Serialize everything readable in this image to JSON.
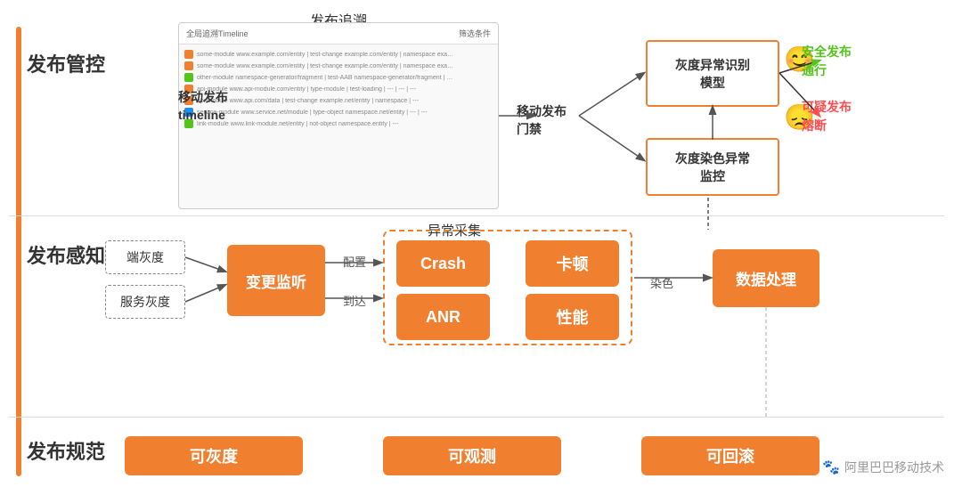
{
  "sections": {
    "fabukongzhi": {
      "label": "发布管控"
    },
    "fabuganzhi": {
      "label": "发布感知"
    },
    "fabuguguifan": {
      "label": "发布规范"
    }
  },
  "top": {
    "trace_title": "发布追溯",
    "mobile_timeline_line1": "移动发布",
    "mobile_timeline_line2": "timeline",
    "mobile_mengeng": "移动发布\n门禁",
    "gray_model": "灰度异常识别\n模型",
    "gray_monitor": "灰度染色异常\n监控",
    "safe_label_line1": "安全发布",
    "safe_label_line2": "通行",
    "suspicious_label_line1": "可疑发布",
    "suspicious_label_line2": "熔断",
    "exception_collect": "异常采集"
  },
  "middle": {
    "duan_gray": "端灰度",
    "service_gray": "服务灰度",
    "change_monitor": "变更监听",
    "config": "配置",
    "arrive": "到达",
    "crash": "Crash",
    "katun": "卡顿",
    "anr": "ANR",
    "performance": "性能",
    "ranse": "染色",
    "data_process": "数据处理"
  },
  "bottom": {
    "kegray": "可灰度",
    "keguance": "可观测",
    "kehui": "可回滚"
  },
  "watermark": "阿里巴巴移动技术",
  "trace_rows": [
    {
      "color": "orange",
      "text": "some-module www.example.com/entity  |  test-change example.com/entity  |  namespace example.com/entity  |  fix  |  ---"
    },
    {
      "color": "orange",
      "text": "some-module www.example.com/entity  |  test-change example.com/entity  |  namespace example.com/entity  |  fix  |  ---"
    },
    {
      "color": "green",
      "text": "other-module namespace-generator/fragment  |  test-AAB namespace-generator/fragment  |  namespace  |  ---  |  ---"
    },
    {
      "color": "orange",
      "text": "api-module www.api-module.com/entity  |  type-module  |  test-loading  |  ---  |  ---  |  ---"
    },
    {
      "color": "orange",
      "text": "api-module www.api.com/data  |  test-change example.net/entity  |  namespace  |  ---"
    },
    {
      "color": "blue",
      "text": "service-module www.service.net/module  |  type-object namespace.net/entity  |  ---  |  ---"
    },
    {
      "color": "green",
      "text": "link-module www.link-module.net/entity  |  not-object namespace.entity  |  ---"
    }
  ]
}
